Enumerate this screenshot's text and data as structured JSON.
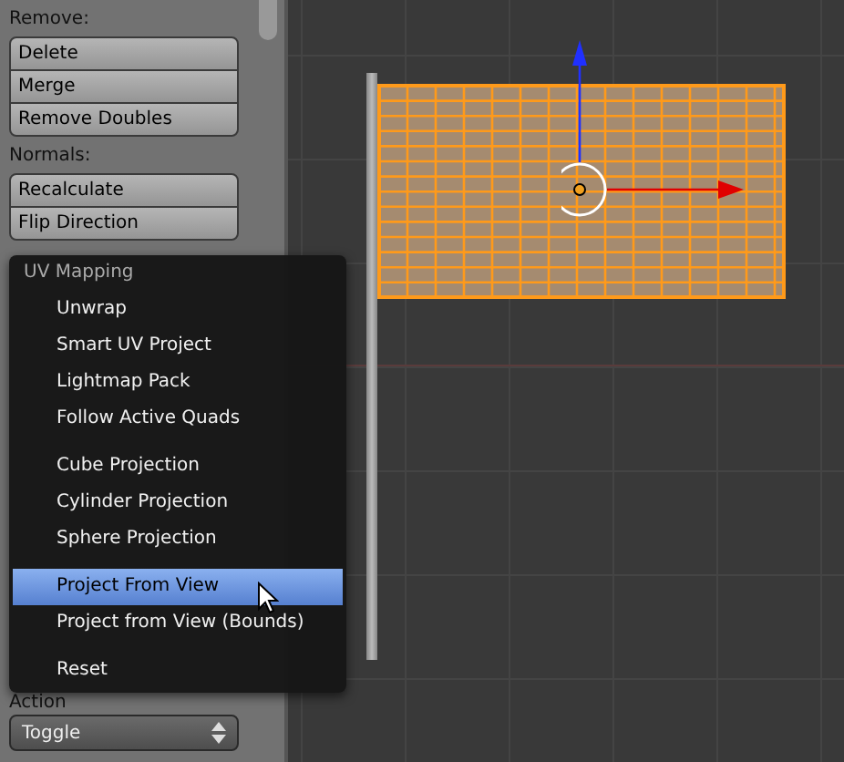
{
  "tool_panel": {
    "sections": [
      {
        "heading": "Remove:",
        "buttons": [
          "Delete",
          "Merge",
          "Remove Doubles"
        ]
      },
      {
        "heading": "Normals:",
        "buttons": [
          "Recalculate",
          "Flip Direction"
        ]
      }
    ],
    "action": {
      "label": "Action",
      "value": "Toggle"
    }
  },
  "uv_menu": {
    "title": "UV Mapping",
    "items": [
      {
        "kind": "item",
        "label": "Unwrap",
        "selected": false
      },
      {
        "kind": "item",
        "label": "Smart UV Project",
        "selected": false
      },
      {
        "kind": "item",
        "label": "Lightmap Pack",
        "selected": false
      },
      {
        "kind": "item",
        "label": "Follow Active Quads",
        "selected": false
      },
      {
        "kind": "separator"
      },
      {
        "kind": "item",
        "label": "Cube Projection",
        "selected": false
      },
      {
        "kind": "item",
        "label": "Cylinder Projection",
        "selected": false
      },
      {
        "kind": "item",
        "label": "Sphere Projection",
        "selected": false
      },
      {
        "kind": "separator"
      },
      {
        "kind": "item",
        "label": "Project From View",
        "selected": true
      },
      {
        "kind": "item",
        "label": "Project from View (Bounds)",
        "selected": false
      },
      {
        "kind": "separator"
      },
      {
        "kind": "item",
        "label": "Reset",
        "selected": false
      }
    ]
  }
}
